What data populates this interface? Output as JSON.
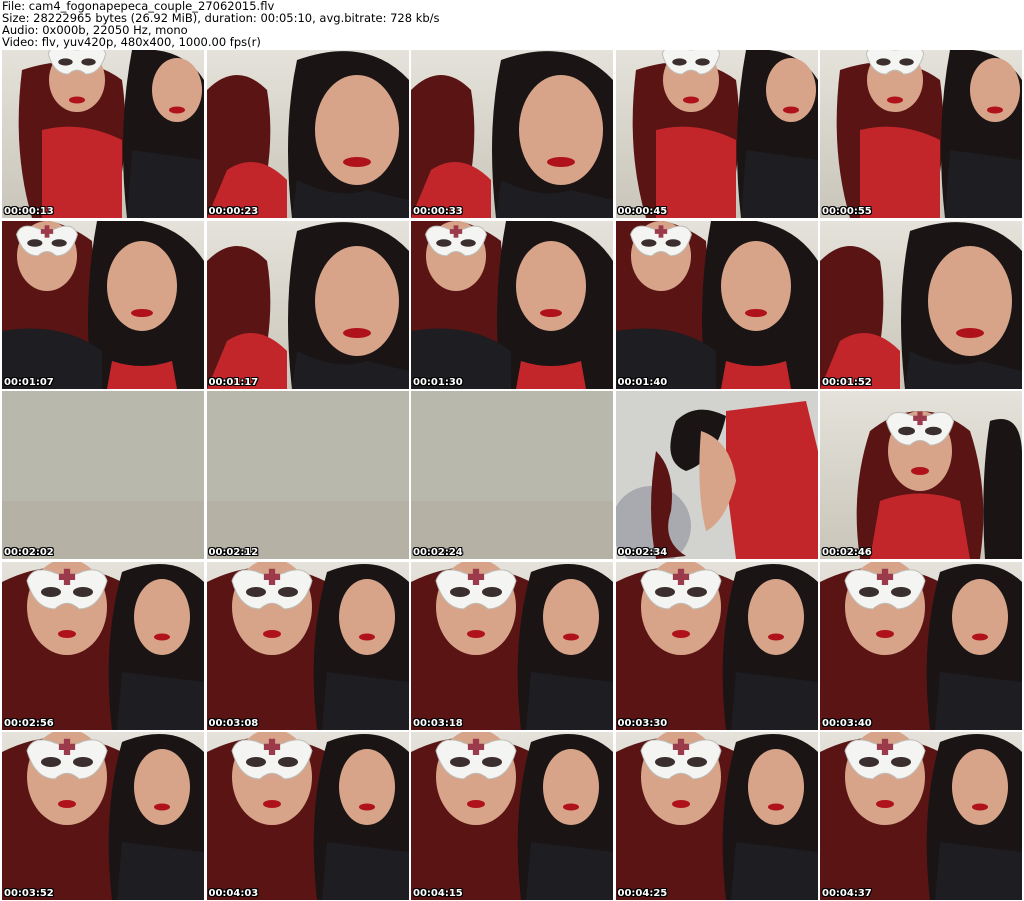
{
  "header": {
    "file_line": "File: cam4_fogonapepeca_couple_27062015.flv",
    "size_line": "Size: 28222965 bytes (26.92 MiB), duration: 00:05:10, avg.bitrate: 728 kb/s",
    "audio_line": "Audio: 0x000b, 22050 Hz, mono",
    "video_line": "Video: flv, yuv420p, 480x400, 1000.00 fps(r)"
  },
  "thumbnails": [
    {
      "timestamp": "00:00:13",
      "scene": "masked-left"
    },
    {
      "timestamp": "00:00:23",
      "scene": "closeup-right"
    },
    {
      "timestamp": "00:00:33",
      "scene": "closeup-right"
    },
    {
      "timestamp": "00:00:45",
      "scene": "masked-left"
    },
    {
      "timestamp": "00:00:55",
      "scene": "masked-left"
    },
    {
      "timestamp": "00:01:07",
      "scene": "mask-cross-left"
    },
    {
      "timestamp": "00:01:17",
      "scene": "closeup-right"
    },
    {
      "timestamp": "00:01:30",
      "scene": "mask-cross-left"
    },
    {
      "timestamp": "00:01:40",
      "scene": "mask-cross-left"
    },
    {
      "timestamp": "00:01:52",
      "scene": "closeup-right"
    },
    {
      "timestamp": "00:02:02",
      "scene": "blank-wall"
    },
    {
      "timestamp": "00:02:12",
      "scene": "blank-wall"
    },
    {
      "timestamp": "00:02:24",
      "scene": "blank-wall"
    },
    {
      "timestamp": "00:02:34",
      "scene": "red-dress-bending"
    },
    {
      "timestamp": "00:02:46",
      "scene": "mask-solo"
    },
    {
      "timestamp": "00:02:56",
      "scene": "big-mask"
    },
    {
      "timestamp": "00:03:08",
      "scene": "big-mask"
    },
    {
      "timestamp": "00:03:18",
      "scene": "big-mask"
    },
    {
      "timestamp": "00:03:30",
      "scene": "big-mask"
    },
    {
      "timestamp": "00:03:40",
      "scene": "big-mask"
    },
    {
      "timestamp": "00:03:52",
      "scene": "big-mask"
    },
    {
      "timestamp": "00:04:03",
      "scene": "big-mask"
    },
    {
      "timestamp": "00:04:15",
      "scene": "big-mask"
    },
    {
      "timestamp": "00:04:25",
      "scene": "big-mask"
    },
    {
      "timestamp": "00:04:37",
      "scene": "big-mask"
    }
  ],
  "colors": {
    "wall": "#dcd9d1",
    "hair": "#1a1414",
    "hair_red": "#5a1414",
    "dress_red": "#c3262a",
    "skin": "#d7a48a",
    "mask": "#f4f4f2",
    "cross": "#9b3a4a",
    "jacket": "#1d1d22",
    "lips": "#b0121c"
  }
}
